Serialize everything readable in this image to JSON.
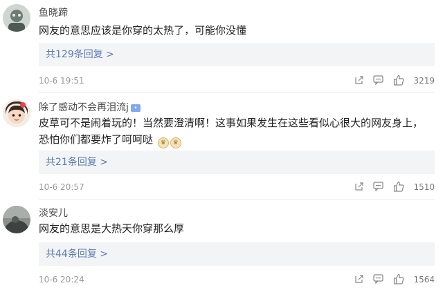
{
  "comments": [
    {
      "username": "鱼晓蹄",
      "text": "网友的意思应该是你穿的太热了，可能你没懂",
      "replies": "共129条回复 >",
      "date": "10-6 19:51",
      "likes": "3219"
    },
    {
      "username": "除了感动不会再泪流j",
      "text": "皮草可不是闹着玩的！当然要澄清啊！这事如果发生在这些看似心很大的网友身上，恐怕你们都要炸了呵呵哒",
      "replies": "共21条回复 >",
      "date": "10-6 20:57",
      "likes": "1510"
    },
    {
      "username": "淡安儿",
      "text": "网友的意思是大热天你穿那么厚",
      "replies": "共44条回复 >",
      "date": "10-6 20:24",
      "likes": "1564"
    }
  ],
  "colors": {
    "reply_link": "#5b7bb3",
    "reply_bg": "#f3f4f6",
    "meta": "#999999"
  },
  "icons": {
    "share": "share-icon",
    "reply": "comment-icon",
    "like": "thumbs-up-icon",
    "badge": "vip-badge-icon"
  }
}
